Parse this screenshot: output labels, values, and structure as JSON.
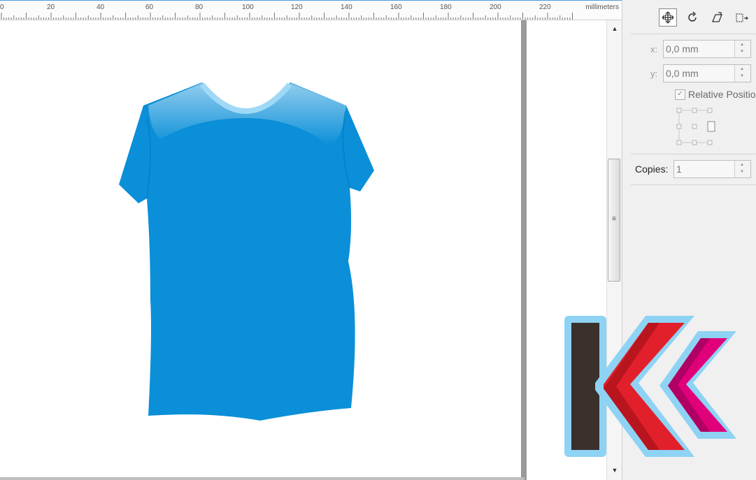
{
  "ruler": {
    "ticks": [
      "0",
      "20",
      "40",
      "60",
      "80",
      "100",
      "120",
      "140",
      "160",
      "180",
      "200",
      "220"
    ],
    "unit": "millimeters"
  },
  "scrollbar": {
    "up_icon": "arrow-up-icon",
    "down_icon": "arrow-down-icon",
    "grip": "≡"
  },
  "panel": {
    "tools": [
      "position-icon",
      "rotate-icon",
      "scale-mirror-icon",
      "size-icon"
    ],
    "x_label": "x:",
    "x_value": "0,0 mm",
    "y_label": "y:",
    "y_value": "0,0 mm",
    "relative_position_label": "Relative Position",
    "relative_position_checked": true,
    "copies_label": "Copies:",
    "copies_value": "1"
  },
  "colors": {
    "shirt": "#0a8fd8",
    "logo_dark": "#3a302c",
    "logo_red": "#e2202b",
    "logo_magenta": "#e0007a",
    "logo_outline": "#8ed3f4"
  }
}
